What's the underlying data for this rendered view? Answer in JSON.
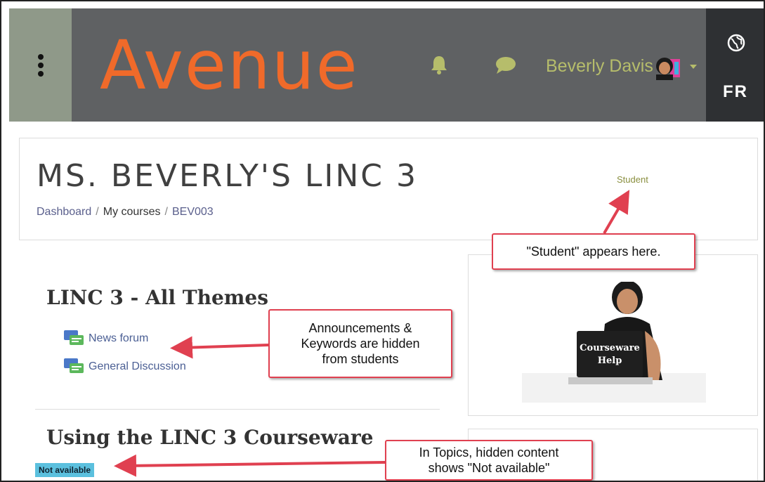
{
  "header": {
    "logo_text": "Avenue",
    "user_name": "Beverly Davis",
    "language": "FR",
    "icons": [
      "menu-dots-icon",
      "bell-icon",
      "chat-icon",
      "avatar",
      "caret-down-icon",
      "globe-icon"
    ],
    "colors": {
      "nav_bg": "#5f6163",
      "logo": "#f06a2a",
      "user": "#b6bd6b",
      "lang_bg": "#2e3033"
    }
  },
  "course": {
    "title": "MS. BEVERLY'S LINC 3",
    "role": "Student",
    "breadcrumb": [
      "Dashboard",
      "My courses",
      "BEV003"
    ]
  },
  "sections": [
    {
      "title": "LINC 3 - All Themes",
      "activities": [
        "News forum",
        "General Discussion"
      ]
    },
    {
      "title": "Using the LINC 3 Courseware",
      "badge": "Not available"
    }
  ],
  "help_image": {
    "label_line1": "Courseware",
    "label_line2": "Help"
  },
  "callouts": {
    "student": "\"Student\" appears here.",
    "hidden_line1": "Announcements &",
    "hidden_line2": "Keywords are hidden",
    "hidden_line3": "from students",
    "topics_line1": "In Topics, hidden content",
    "topics_line2": "shows \"Not available\"",
    "color": "#e04050"
  }
}
